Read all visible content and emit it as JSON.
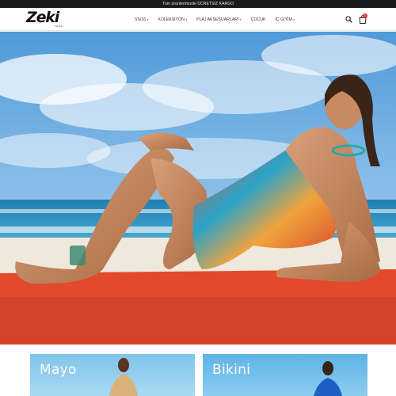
{
  "topbar": {
    "announcement": "Tüm ürünlerimizde ÜCRETSİZ KARGO"
  },
  "brand": {
    "name": "Zeki",
    "sub": "TRIKO"
  },
  "nav": {
    "items": [
      {
        "label": "SS/16",
        "has_dropdown": true
      },
      {
        "label": "KOLEKSİYON",
        "has_dropdown": true
      },
      {
        "label": "PLAJ AKSESUARLARI",
        "has_dropdown": true
      },
      {
        "label": "ÇOCUK",
        "has_dropdown": false
      },
      {
        "label": "İÇ GİYİM",
        "has_dropdown": true
      }
    ],
    "caret": "▾"
  },
  "header_icons": {
    "search": "search-icon",
    "cart": "shopping-bag-icon",
    "cart_count": "0"
  },
  "hero": {
    "slides": 4,
    "active_slide": 1
  },
  "categories": [
    {
      "title": "Mayo"
    },
    {
      "title": "Bikini"
    }
  ],
  "colors": {
    "accent": "#e0282e",
    "topbar": "#1b1b1b",
    "hero_platform": "#e24a2b"
  }
}
